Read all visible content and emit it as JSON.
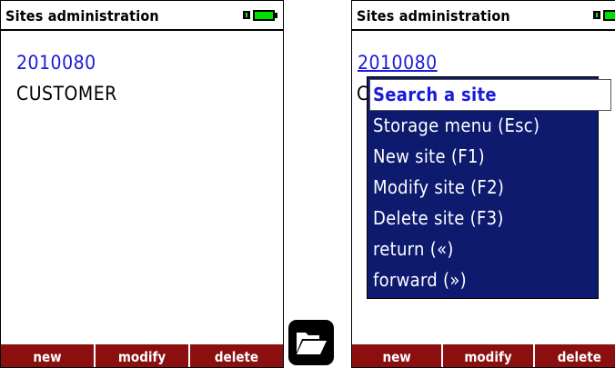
{
  "screens": {
    "left": {
      "title": "Sites administration",
      "site_id": "2010080",
      "site_name": "CUSTOMER",
      "softkeys": [
        "new",
        "modify",
        "delete"
      ]
    },
    "right": {
      "title": "Sites administration",
      "site_id": "2010080",
      "site_name_partial": "C",
      "softkeys": [
        "new",
        "modify",
        "delete"
      ],
      "context_menu": {
        "items": [
          "Search a site",
          "Storage menu (Esc)",
          "New site (F1)",
          "Modify site (F2)",
          "Delete site (F3)",
          "return («)",
          "forward (»)"
        ],
        "selected_index": 0
      }
    }
  },
  "colors": {
    "softkey_bar": "#8b0f0f",
    "menu_background": "#0d1a6e",
    "site_id_text": "#1a1ad8",
    "battery_fill": "#00e000"
  },
  "icons": {
    "battery": "battery-icon",
    "folder": "folder-open-icon"
  }
}
